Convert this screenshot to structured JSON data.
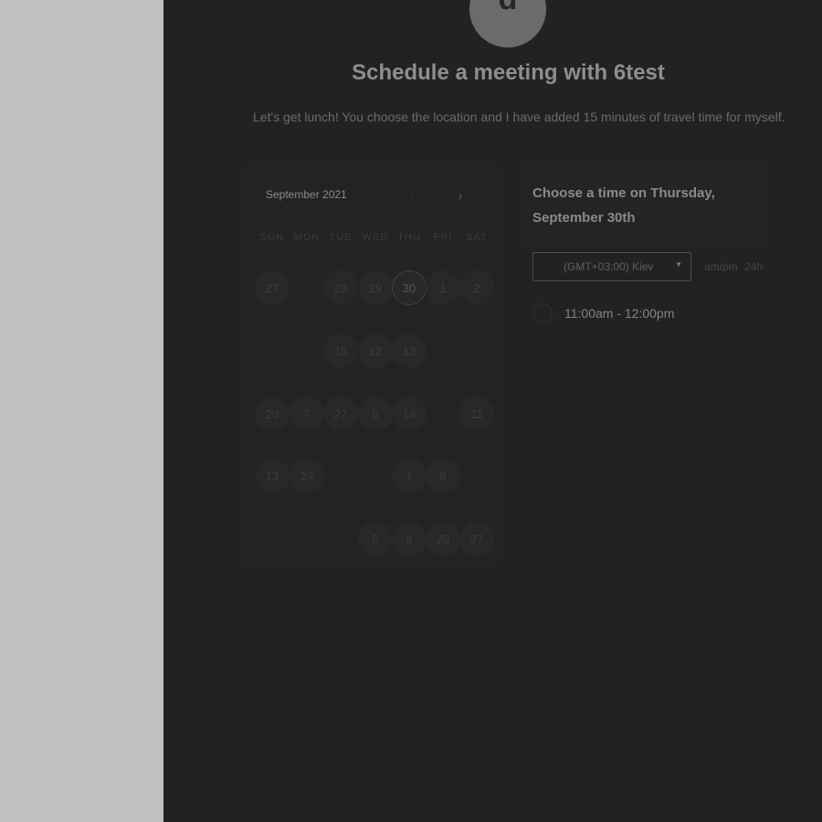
{
  "colors": {
    "page_background": "#c0c0c0",
    "panel_background": "#222222",
    "title_text": "#8e8e8e"
  },
  "header": {
    "avatar_letter": "d",
    "title": "Schedule a meeting with 6test",
    "description": "Let's get lunch! You choose the location and I have added 15 minutes of travel time for myself."
  },
  "calendar": {
    "month_label": "September 2021",
    "prev_icon": "chevron-left-icon",
    "next_icon": "chevron-right-icon",
    "weekdays": [
      "SUN",
      "MON",
      "TUE",
      "WED",
      "THU",
      "FRI",
      "SAT"
    ],
    "selected_day": "30",
    "days": [
      [
        "27",
        "",
        "28",
        "29",
        "30",
        "1",
        "2"
      ],
      [
        "",
        "",
        "15",
        "12",
        "13",
        "",
        ""
      ],
      [
        "20",
        "7",
        "27",
        "8",
        "14",
        "",
        "11"
      ],
      [
        "13",
        "29",
        "",
        "",
        "1",
        "8",
        ""
      ],
      [
        "",
        "",
        "",
        "5",
        "6",
        "20",
        "27"
      ]
    ]
  },
  "time_panel": {
    "heading": "Choose a time on Thursday, September 30th",
    "timezone": "(GMT+03:00) Kiev",
    "timezone_icon": "caret-down-icon",
    "format_ampm": "am/pm",
    "format_24h": "24h",
    "slots": [
      "11:00am - 12:00pm"
    ]
  }
}
